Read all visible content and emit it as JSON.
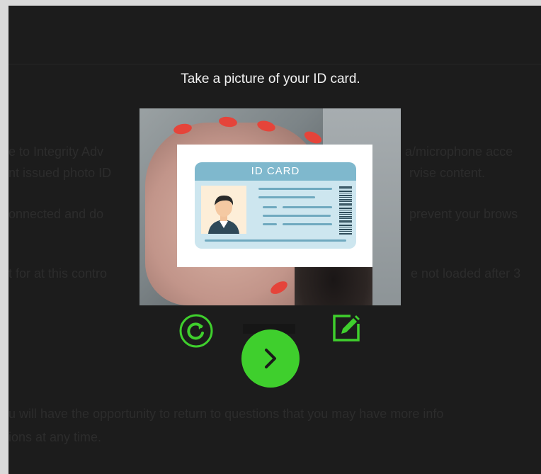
{
  "modal": {
    "title": "Take a picture of your ID card.",
    "card_label": "ID CARD"
  },
  "controls": {
    "retake_icon": "retake-rotate-icon",
    "edit_icon": "edit-pencil-icon",
    "next_icon": "chevron-right-icon"
  },
  "background_text": [
    "e to Integrity Adv",
    "nt issued photo ID",
    "onnected and do",
    "t for at this contro",
    "u will have the opportunity to return to questions that you may have more info",
    "ions at any time."
  ],
  "background_text_right": [
    "a/microphone acce",
    "rvise content.",
    "prevent your brows",
    "e not loaded after 3"
  ],
  "colors": {
    "accent": "#3fcf2d",
    "modal_bg": "#1c1c1c",
    "title_text": "#f2f2f2"
  }
}
